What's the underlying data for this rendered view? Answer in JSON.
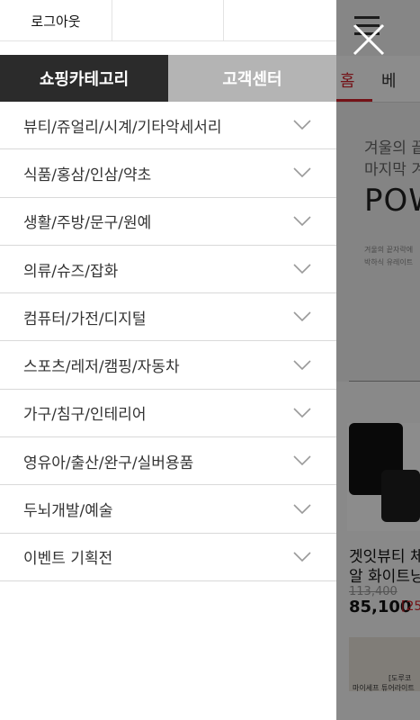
{
  "top_links": [
    "로그아웃",
    "",
    ""
  ],
  "tabs": [
    {
      "label": "쇼핑카테고리",
      "active": true
    },
    {
      "label": "고객센터",
      "active": false
    }
  ],
  "categories": [
    "뷰티/쥬얼리/시계/기타악세서리",
    "식품/홍삼/인삼/약초",
    "생활/주방/문구/원예",
    "의류/슈즈/잡화",
    "컴퓨터/가전/디지털",
    "스포츠/레저/캠핑/자동차",
    "가구/침구/인테리어",
    "영유아/출산/완구/실버용품",
    "두뇌개발/예술",
    "이벤트 기획전"
  ],
  "background": {
    "tabs": [
      "홈",
      "베"
    ],
    "banner_lines": [
      "겨울의 끝",
      "마지막 겨"
    ],
    "banner_title": "POW",
    "banner_small": [
      "겨울의 끝자락에",
      "박하식 유레이트"
    ],
    "product_name": [
      "겟잇뷰티 체",
      "알 화이트닝"
    ],
    "price_old": "113,400",
    "price": "85,100",
    "discount": "[25",
    "thumb_text": [
      "[도루코",
      "마이세프 튜어라이트"
    ]
  },
  "colors": {
    "accent": "#d3222a",
    "tab_active_bg": "#2b2b2b",
    "tab_inactive_bg": "#b4b4b4"
  },
  "icons": {
    "close": "close-icon",
    "menu": "hamburger-icon",
    "expand": "chevron-down-icon"
  }
}
